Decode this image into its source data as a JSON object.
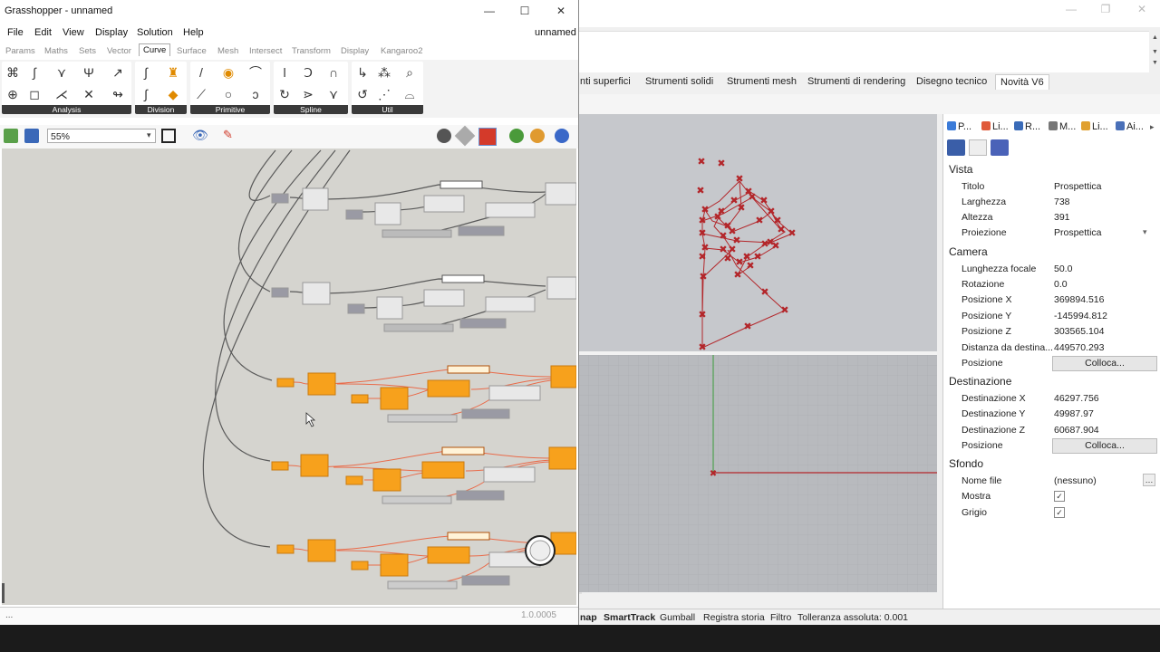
{
  "grasshopper": {
    "title": "Grasshopper - unnamed",
    "doc_name": "unnamed",
    "menu": [
      "File",
      "Edit",
      "View",
      "Display",
      "Solution",
      "Help"
    ],
    "tabs": [
      "Params",
      "Maths",
      "Sets",
      "Vector",
      "Curve",
      "Surface",
      "Mesh",
      "Intersect",
      "Transform",
      "Display",
      "Kangaroo2"
    ],
    "active_tab": "Curve",
    "groups": [
      "Analysis",
      "Division",
      "Primitive",
      "Spline",
      "Util"
    ],
    "zoom": "55%",
    "version": "1.0.0005",
    "status_left": "..."
  },
  "rhino": {
    "tabs": [
      "nti superfici",
      "Strumenti solidi",
      "Strumenti mesh",
      "Strumenti di rendering",
      "Disegno tecnico",
      "Novità V6"
    ],
    "active_tab": "Novità V6",
    "panel_tabs": [
      "P...",
      "Li...",
      "R...",
      "M...",
      "Li...",
      "Ai..."
    ],
    "sections": {
      "vista": {
        "title": "Vista",
        "rows": [
          {
            "label": "Titolo",
            "value": "Prospettica"
          },
          {
            "label": "Larghezza",
            "value": "738"
          },
          {
            "label": "Altezza",
            "value": "391"
          },
          {
            "label": "Proiezione",
            "value": "Prospettica"
          }
        ]
      },
      "camera": {
        "title": "Camera",
        "rows": [
          {
            "label": "Lunghezza focale",
            "value": "50.0"
          },
          {
            "label": "Rotazione",
            "value": "0.0"
          },
          {
            "label": "Posizione X",
            "value": "369894.516"
          },
          {
            "label": "Posizione Y",
            "value": "-145994.812"
          },
          {
            "label": "Posizione Z",
            "value": "303565.104"
          },
          {
            "label": "Distanza da destina...",
            "value": "449570.293"
          },
          {
            "label": "Posizione",
            "value": "Colloca..."
          }
        ]
      },
      "destinazione": {
        "title": "Destinazione",
        "rows": [
          {
            "label": "Destinazione X",
            "value": "46297.756"
          },
          {
            "label": "Destinazione Y",
            "value": "49987.97"
          },
          {
            "label": "Destinazione Z",
            "value": "60687.904"
          },
          {
            "label": "Posizione",
            "value": "Colloca..."
          }
        ]
      },
      "sfondo": {
        "title": "Sfondo",
        "rows": [
          {
            "label": "Nome file",
            "value": "(nessuno)"
          },
          {
            "label": "Mostra",
            "value": "✓"
          },
          {
            "label": "Grigio",
            "value": "✓"
          }
        ]
      }
    },
    "status": [
      "nap",
      "SmartTrack",
      "Gumball",
      "Registra storia",
      "Filtro",
      "Tolleranza assoluta: 0.001"
    ],
    "colors": {
      "accent": "#b3262a",
      "gh_orange": "#f7a11c",
      "gh_wire_orange": "#e96b4a"
    }
  }
}
